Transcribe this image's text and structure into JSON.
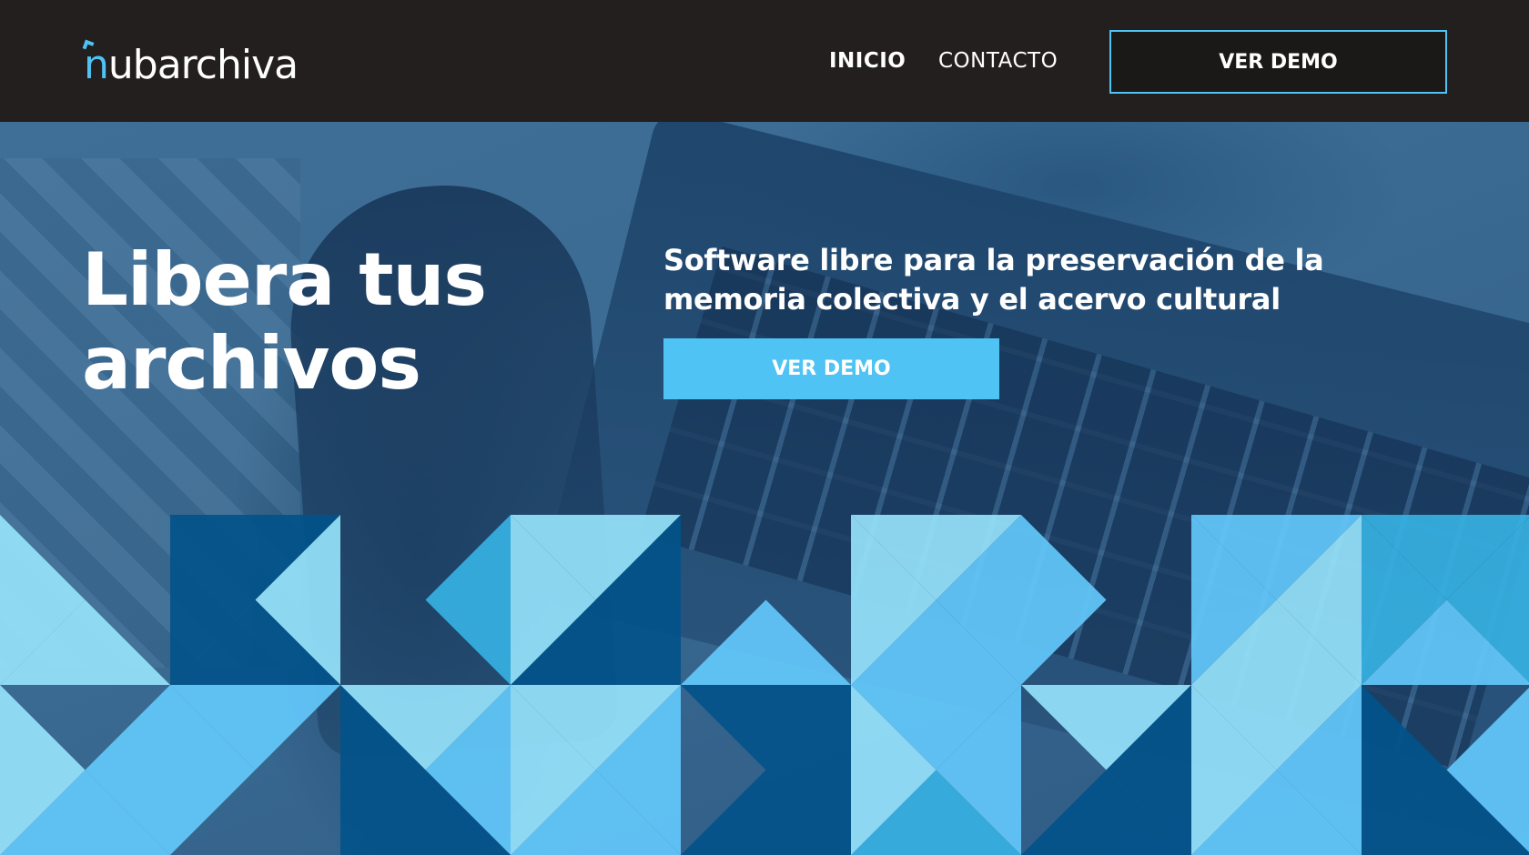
{
  "brand": {
    "name": "nubarchiva",
    "accent": "#4ec3f4"
  },
  "nav": {
    "links": [
      {
        "label": "INICIO",
        "active": true
      },
      {
        "label": "CONTACTO",
        "active": false
      }
    ],
    "demo_button": "VER DEMO"
  },
  "hero": {
    "title_line1": "Libera tus",
    "title_line2": "archivos",
    "subtitle": "Software libre para la preservación de la memoria colectiva y el acervo cultural",
    "demo_button": "VER DEMO"
  },
  "colors": {
    "navbar": "#231f1f",
    "button_blue": "#4ec3f4",
    "pattern_light": "#96e2fb",
    "pattern_mid": "#63c8fb",
    "pattern_sky": "#36b1e2",
    "pattern_dark": "#02528a"
  }
}
